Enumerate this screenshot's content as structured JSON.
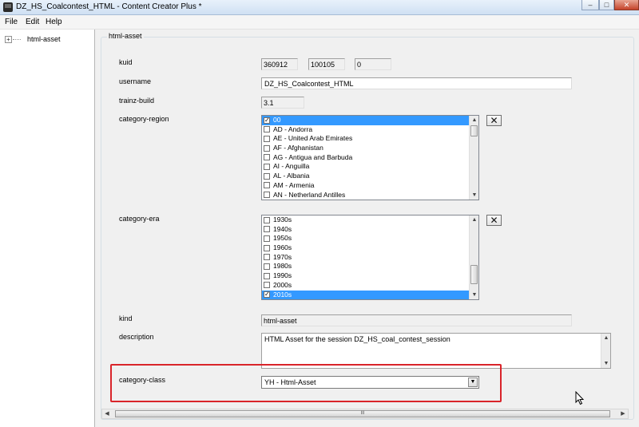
{
  "window": {
    "title": "DZ_HS_Coalcontest_HTML - Content Creator Plus *",
    "minimize": "–",
    "maximize": "□",
    "close": "✕"
  },
  "menu": [
    "File",
    "Edit",
    "Help"
  ],
  "tree": {
    "expander": "+",
    "items": [
      {
        "label": "html-asset"
      }
    ]
  },
  "panel": {
    "group_title": "html-asset",
    "kuid": {
      "label": "kuid",
      "values": [
        "360912",
        "100105",
        "0"
      ]
    },
    "username": {
      "label": "username",
      "value": "DZ_HS_Coalcontest_HTML"
    },
    "trainz_build": {
      "label": "trainz-build",
      "value": "3.1"
    },
    "category_region": {
      "label": "category-region",
      "items": [
        {
          "text": "00",
          "checked": true,
          "selected": true
        },
        {
          "text": "AD - Andorra",
          "checked": false
        },
        {
          "text": "AE - United Arab Emirates",
          "checked": false
        },
        {
          "text": "AF - Afghanistan",
          "checked": false
        },
        {
          "text": "AG - Antigua and Barbuda",
          "checked": false
        },
        {
          "text": "AI - Anguilla",
          "checked": false
        },
        {
          "text": "AL - Albania",
          "checked": false
        },
        {
          "text": "AM - Armenia",
          "checked": false
        },
        {
          "text": "AN - Netherland Antilles",
          "checked": false
        }
      ],
      "clear_button": "✕"
    },
    "category_era": {
      "label": "category-era",
      "items": [
        {
          "text": "1930s",
          "checked": false
        },
        {
          "text": "1940s",
          "checked": false
        },
        {
          "text": "1950s",
          "checked": false
        },
        {
          "text": "1960s",
          "checked": false
        },
        {
          "text": "1970s",
          "checked": false
        },
        {
          "text": "1980s",
          "checked": false
        },
        {
          "text": "1990s",
          "checked": false
        },
        {
          "text": "2000s",
          "checked": false
        },
        {
          "text": "2010s",
          "checked": true,
          "selected": true
        }
      ],
      "clear_button": "✕"
    },
    "kind": {
      "label": "kind",
      "value": "html-asset"
    },
    "description": {
      "label": "description",
      "value": "HTML Asset for the session DZ_HS_coal_contest_session"
    },
    "category_class": {
      "label": "category-class",
      "value": "YH - Html-Asset"
    }
  },
  "scroll": {
    "up": "▲",
    "down": "▼",
    "left": "◀",
    "right": "▶",
    "grip": "III"
  },
  "colors": {
    "selection": "#3399ff",
    "highlight_border": "#d9242a"
  }
}
